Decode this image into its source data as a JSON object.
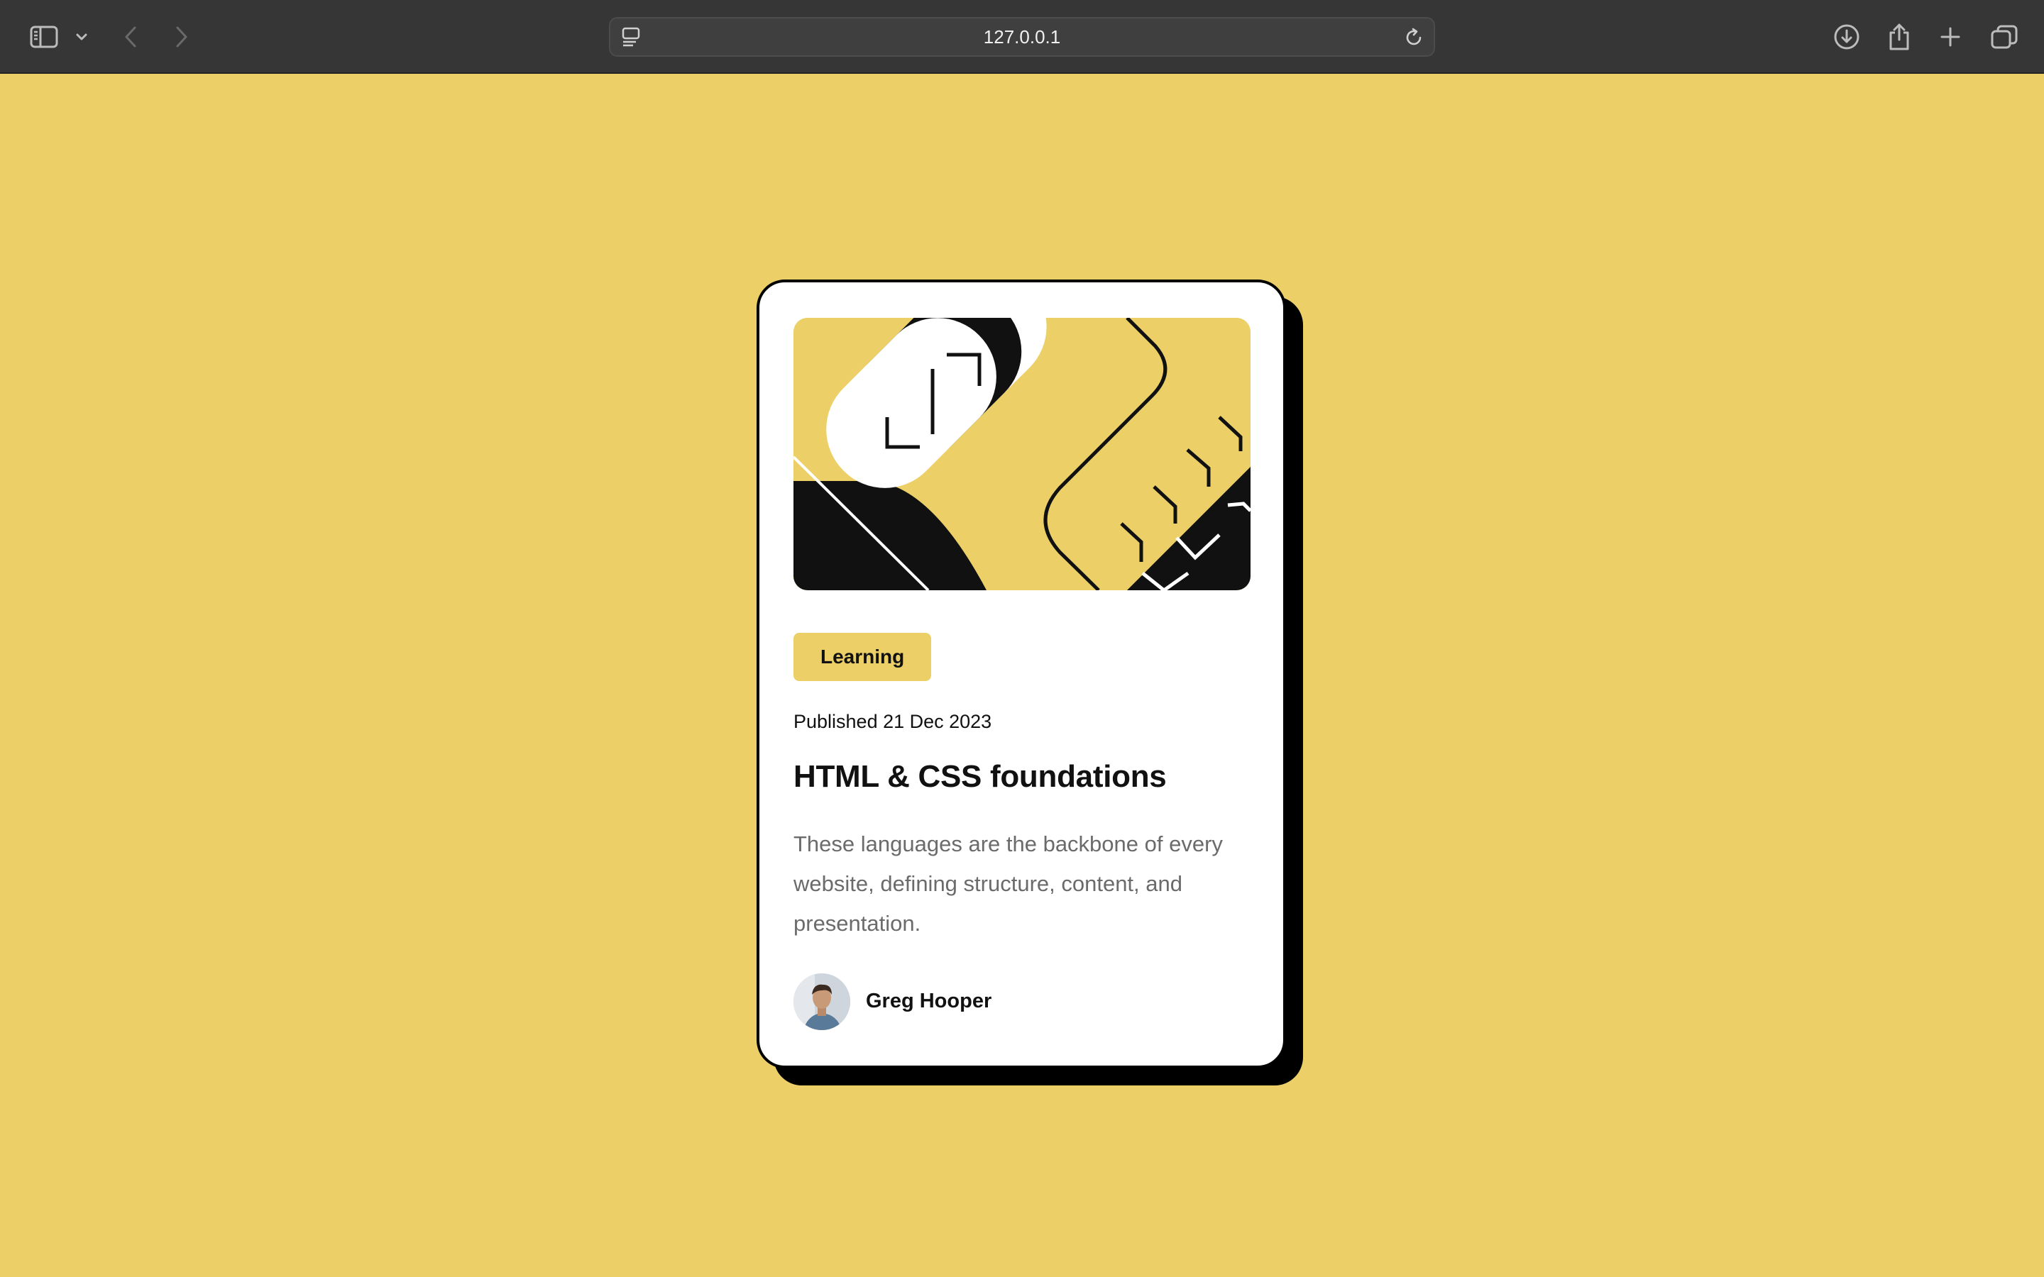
{
  "browser": {
    "url": "127.0.0.1",
    "icons": [
      "sidebar-icon",
      "chevron-down-icon",
      "back-arrow-icon",
      "forward-arrow-icon",
      "page-icon",
      "reload-icon",
      "download-icon",
      "share-icon",
      "plus-icon",
      "tabs-icon"
    ]
  },
  "card": {
    "tag": "Learning",
    "published": "Published 21 Dec 2023",
    "title": "HTML & CSS foundations",
    "description": "These languages are the backbone of every website, defining structure, content, and presentation.",
    "author": "Greg Hooper"
  },
  "colors": {
    "background": "#ecd067",
    "card": "#ffffff",
    "ink": "#111111",
    "muted": "#6b6b6b",
    "toolbar": "#363636"
  }
}
